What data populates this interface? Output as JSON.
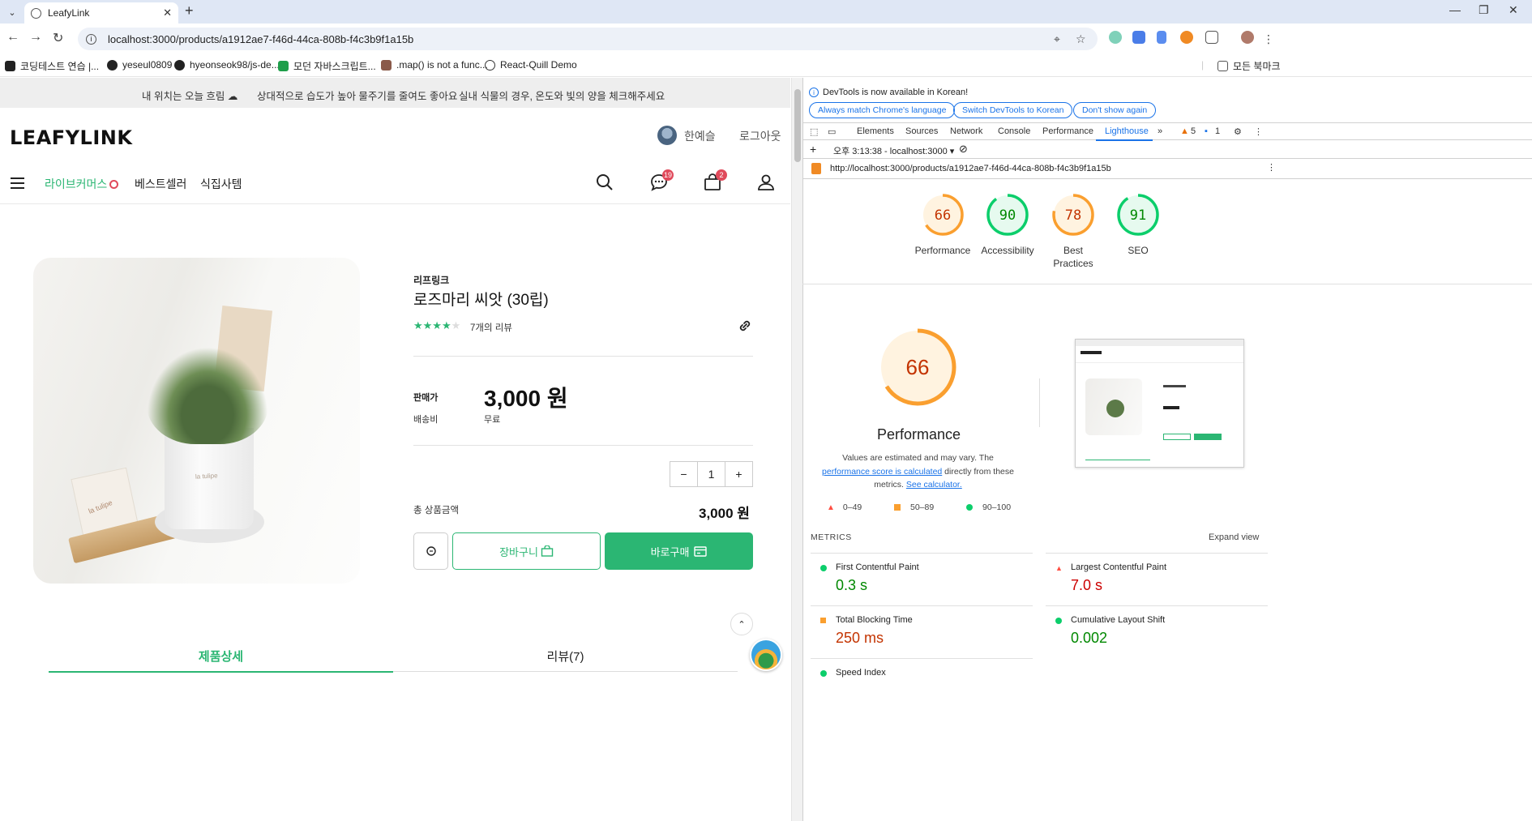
{
  "browser": {
    "tab_title": "LeafyLink",
    "url": "localhost:3000/products/a1912ae7-f46d-44ca-808b-f4c3b9f1a15b",
    "bookmarks": [
      "코딩테스트 연습 |...",
      "yeseul0809",
      "hyeonseok98/js-de...",
      "모던 자바스크립트...",
      ".map() is not a func...",
      "React-Quill Demo"
    ],
    "all_bookmarks": "모든 북마크"
  },
  "weather_bar": {
    "item1": "내 위치는 오늘 흐림",
    "item2": "상대적으로 습도가 높아 물주기를 줄여도 좋아요",
    "item3": "실내 식물의 경우, 온도와 빛의 양을 체크해주세요"
  },
  "header": {
    "logo": "LEAFYLINK",
    "user_name": "한예슬",
    "logout": "로그아웃",
    "nav": [
      "라이브커머스",
      "베스트셀러",
      "식집사템"
    ],
    "chat_badge": "19",
    "cart_badge": "2"
  },
  "product": {
    "brand": "리프링크",
    "title": "로즈마리 씨앗 (30립)",
    "rating": 4,
    "reviews": "7개의 리뷰",
    "price_label": "판매가",
    "price": "3,000 원",
    "shipping_label": "배송비",
    "shipping": "무료",
    "quantity": "1",
    "total_label": "총 상품금액",
    "total": "3,000 원",
    "cart_button": "장바구니",
    "buy_button": "바로구매",
    "tabs": [
      "제품상세",
      "리뷰(7)"
    ],
    "image_text": "la tulipe"
  },
  "devtools": {
    "notice": "DevTools is now available in Korean!",
    "pills": [
      "Always match Chrome's language",
      "Switch DevTools to Korean",
      "Don't show again"
    ],
    "tabs": [
      "Elements",
      "Sources",
      "Network",
      "Console",
      "Performance",
      "Lighthouse"
    ],
    "warnings": "5",
    "messages": "1",
    "report_time": "오후 3:13:38 - localhost:3000",
    "report_url": "http://localhost:3000/products/a1912ae7-f46d-44ca-808b-f4c3b9f1a15b",
    "scores": [
      {
        "label": "Performance",
        "value": 66,
        "color": "#fa9f2f"
      },
      {
        "label": "Accessibility",
        "value": 90,
        "color": "#0cce6b"
      },
      {
        "label": "Best Practices",
        "value": 78,
        "color": "#fa9f2f"
      },
      {
        "label": "SEO",
        "value": 91,
        "color": "#0cce6b"
      }
    ],
    "big_score": 66,
    "big_label": "Performance",
    "desc_pre": "Values are estimated and may vary. The ",
    "desc_link1": "performance score is calculated",
    "desc_mid": " directly from these metrics. ",
    "desc_link2": "See calculator.",
    "legend": [
      "0–49",
      "50–89",
      "90–100"
    ],
    "metrics_header": "METRICS",
    "expand": "Expand view",
    "metrics": [
      {
        "name": "First Contentful Paint",
        "value": "0.3 s",
        "status": "good"
      },
      {
        "name": "Largest Contentful Paint",
        "value": "7.0 s",
        "status": "poor"
      },
      {
        "name": "Total Blocking Time",
        "value": "250 ms",
        "status": "average"
      },
      {
        "name": "Cumulative Layout Shift",
        "value": "0.002",
        "status": "good"
      },
      {
        "name": "Speed Index",
        "value": "",
        "status": "good"
      }
    ]
  },
  "colors": {
    "brand_green": "#2bb673",
    "good": "#0cce6b",
    "average": "#fa9f2f",
    "poor": "#ff4e42",
    "link": "#1a73e8"
  }
}
